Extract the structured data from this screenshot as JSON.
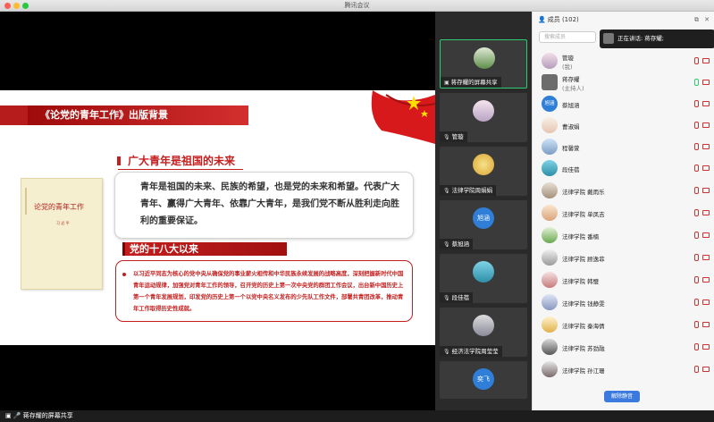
{
  "window": {
    "title": "腾讯会议"
  },
  "share": {
    "banner": "《论党的青年工作》出版背景",
    "book_title": "论党的青年工作",
    "book_author": "习 近 平",
    "heading1": "广大青年是祖国的未来",
    "paragraph1": "青年是祖国的未来、民族的希望，也是党的未来和希望。代表广大青年、赢得广大青年、依靠广大青年，是我们党不断从胜利走向胜利的重要保证。",
    "heading2": "党的十八大以来",
    "paragraph2": "以习近平同志为核心的党中央从确保党的事业薪火相传和中华民族永续发展的战略高度，深刻把握新时代中国青年运动规律，加强党对青年工作的领导，召开党的历史上第一次中央党的群团工作会议，出台新中国历史上第一个青年发展规划，印发党的历史上第一个以党中央名义发布的少先队工作文件，部署共青团改革，推动青年工作取得历史性成就。",
    "sharer_label": "蒋存耀的屏幕共享"
  },
  "thumbnails": [
    {
      "label": "蒋存耀的屏幕共享",
      "avatar_text": "",
      "active": true
    },
    {
      "label": "管璇",
      "avatar_text": ""
    },
    {
      "label": "法律学院周娟娟",
      "avatar_text": ""
    },
    {
      "label": "蔡旭涵",
      "avatar_text": "旭涵"
    },
    {
      "label": "段佳蓓",
      "avatar_text": ""
    },
    {
      "label": "经济法学院周莹莹",
      "avatar_text": ""
    },
    {
      "label": "",
      "avatar_text": "奕飞"
    }
  ],
  "panel": {
    "title": "成员 (102)",
    "search_placeholder": "搜索成员",
    "speaking_toast": "正在讲话: 蒋存耀;",
    "mute_all": "解除静音",
    "members": [
      {
        "name": "管璇",
        "sub": "(我)",
        "avatar_text": ""
      },
      {
        "name": "蒋存耀",
        "sub": "(主持人)",
        "avatar_text": ""
      },
      {
        "name": "蔡旭涵",
        "sub": "",
        "avatar_text": "旭涵"
      },
      {
        "name": "曹淑娟",
        "sub": "",
        "avatar_text": ""
      },
      {
        "name": "程馨萱",
        "sub": "",
        "avatar_text": ""
      },
      {
        "name": "段佳蓓",
        "sub": "",
        "avatar_text": ""
      },
      {
        "name": "法律学院 戴雨乐",
        "sub": "",
        "avatar_text": ""
      },
      {
        "name": "法律学院 单凤吉",
        "sub": "",
        "avatar_text": ""
      },
      {
        "name": "法律学院 番楠",
        "sub": "",
        "avatar_text": ""
      },
      {
        "name": "法律学院 顾逸菲",
        "sub": "",
        "avatar_text": ""
      },
      {
        "name": "法律学院 韩璧",
        "sub": "",
        "avatar_text": ""
      },
      {
        "name": "法律学院 钱静雯",
        "sub": "",
        "avatar_text": ""
      },
      {
        "name": "法律学院 秦海倩",
        "sub": "",
        "avatar_text": ""
      },
      {
        "name": "法律学院 苏劲融",
        "sub": "",
        "avatar_text": ""
      },
      {
        "name": "法律学院 孙江珊",
        "sub": "",
        "avatar_text": ""
      }
    ]
  }
}
